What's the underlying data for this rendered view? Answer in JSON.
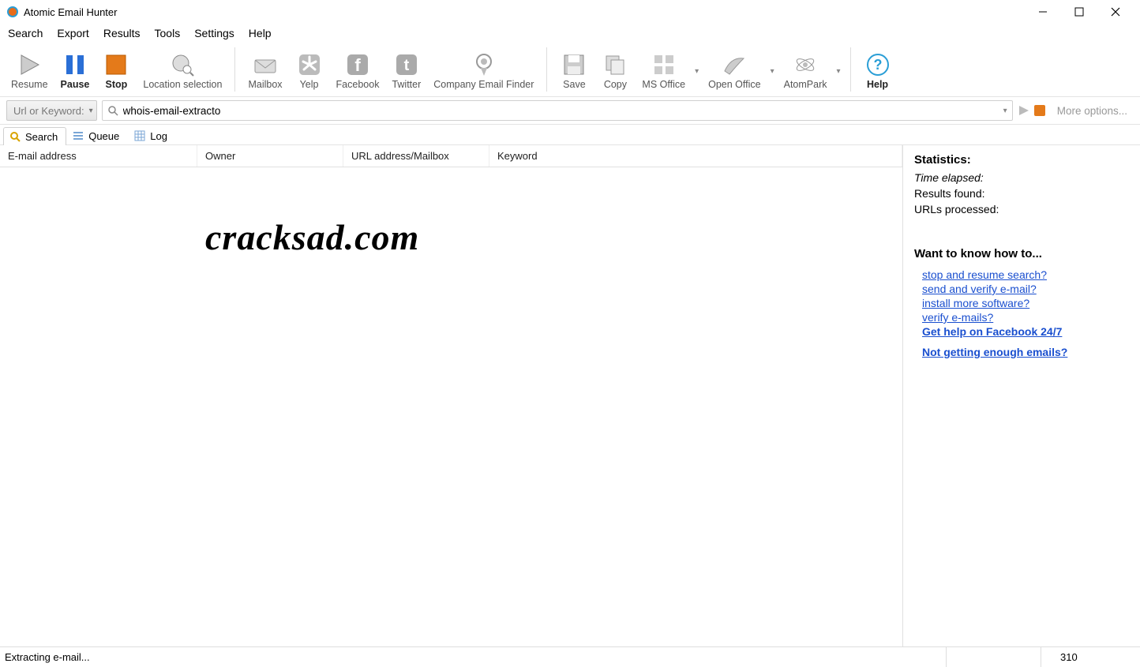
{
  "app": {
    "title": "Atomic Email Hunter"
  },
  "menu": {
    "items": [
      "Search",
      "Export",
      "Results",
      "Tools",
      "Settings",
      "Help"
    ]
  },
  "toolbar": {
    "resume": "Resume",
    "pause": "Pause",
    "stop": "Stop",
    "location": "Location selection",
    "mailbox": "Mailbox",
    "yelp": "Yelp",
    "facebook": "Facebook",
    "twitter": "Twitter",
    "cef": "Company Email Finder",
    "save": "Save",
    "copy": "Copy",
    "msoffice": "MS Office",
    "openoffice": "Open Office",
    "atompark": "AtomPark",
    "help": "Help"
  },
  "addrbar": {
    "mode": "Url or Keyword:",
    "search_value": "whois-email-extracto",
    "more": "More options..."
  },
  "tabs": {
    "search": "Search",
    "queue": "Queue",
    "log": "Log"
  },
  "columns": {
    "email": "E-mail address",
    "owner": "Owner",
    "url": "URL address/Mailbox",
    "keyword": "Keyword"
  },
  "watermark": "cracksad.com",
  "stats": {
    "heading": "Statistics:",
    "time": "Time elapsed:",
    "results": "Results found:",
    "urls": "URLs processed:"
  },
  "howto": {
    "heading": "Want to know how to...",
    "links": [
      "stop and resume search?",
      "send and verify e-mail?",
      "install more software?",
      "verify e-mails?"
    ],
    "fb": "Get help on Facebook 24/7",
    "noemails": "Not getting enough emails?"
  },
  "status": {
    "left": "Extracting e-mail...",
    "right": "310"
  }
}
